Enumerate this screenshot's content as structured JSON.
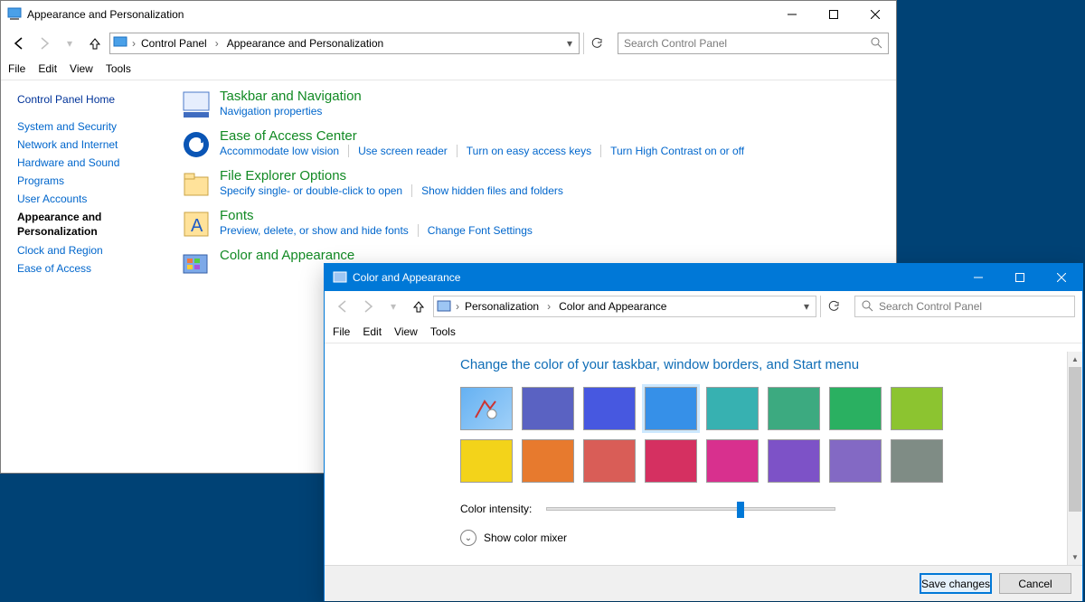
{
  "win1": {
    "title": "Appearance and Personalization",
    "breadcrumb": [
      "Control Panel",
      "Appearance and Personalization"
    ],
    "search_placeholder": "Search Control Panel",
    "menu": [
      "File",
      "Edit",
      "View",
      "Tools"
    ],
    "sidebar_home": "Control Panel Home",
    "sidebar": [
      "System and Security",
      "Network and Internet",
      "Hardware and Sound",
      "Programs",
      "User Accounts",
      "Appearance and Personalization",
      "Clock and Region",
      "Ease of Access"
    ],
    "current_sidebar": "Appearance and Personalization",
    "categories": [
      {
        "title": "Taskbar and Navigation",
        "links": [
          "Navigation properties"
        ]
      },
      {
        "title": "Ease of Access Center",
        "links": [
          "Accommodate low vision",
          "Use screen reader",
          "Turn on easy access keys",
          "Turn High Contrast on or off"
        ]
      },
      {
        "title": "File Explorer Options",
        "links": [
          "Specify single- or double-click to open",
          "Show hidden files and folders"
        ]
      },
      {
        "title": "Fonts",
        "links": [
          "Preview, delete, or show and hide fonts",
          "Change Font Settings"
        ]
      },
      {
        "title": "Color and Appearance",
        "links": []
      }
    ]
  },
  "win2": {
    "title": "Color and Appearance",
    "breadcrumb": [
      "Personalization",
      "Color and Appearance"
    ],
    "search_placeholder": "Search Control Panel",
    "menu": [
      "File",
      "Edit",
      "View",
      "Tools"
    ],
    "heading": "Change the color of your taskbar, window borders, and Start menu",
    "colors": [
      "automatic",
      "#5a62c2",
      "#4758e0",
      "#3690e8",
      "#37b1b1",
      "#3caa80",
      "#2ab061",
      "#8cc430",
      "#f3d31a",
      "#e77a2e",
      "#d95d57",
      "#d53061",
      "#d8308e",
      "#7d52c7",
      "#8369c4",
      "#7f8c85"
    ],
    "selected_color_index": 3,
    "intensity_label": "Color intensity:",
    "intensity_value": 66,
    "mixer_label": "Show color mixer",
    "save_button": "Save changes",
    "cancel_button": "Cancel"
  }
}
